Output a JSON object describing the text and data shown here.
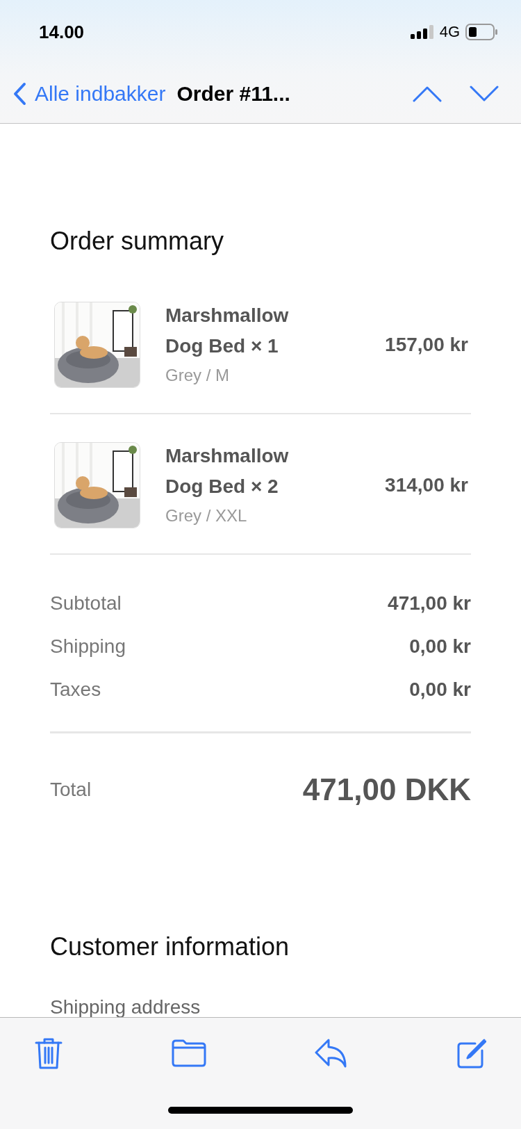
{
  "status_bar": {
    "time": "14.00",
    "network": "4G"
  },
  "nav": {
    "back_label": "Alle indbakker",
    "title": "Order #11..."
  },
  "order_summary": {
    "heading": "Order summary",
    "items": [
      {
        "kind": "picture",
        "name": "Marshmallow Dog Bed × 1",
        "variant": "Grey / M",
        "price": "157,00 kr"
      },
      {
        "kind": "picture",
        "name": "Marshmallow Dog Bed × 2",
        "variant": "Grey / XXL",
        "price": "314,00 kr"
      }
    ],
    "costs": [
      {
        "label": "Subtotal",
        "value": "471,00 kr"
      },
      {
        "label": "Shipping",
        "value": "0,00 kr"
      },
      {
        "label": "Taxes",
        "value": "0,00 kr"
      }
    ],
    "total": {
      "label": "Total",
      "value": "471,00 DKK"
    }
  },
  "customer_information": {
    "heading": "Customer information",
    "shipping_address_label": "Shipping address"
  }
}
